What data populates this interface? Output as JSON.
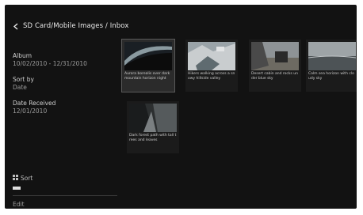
{
  "header": {
    "breadcrumb": "SD Card/Mobile Images / Inbox"
  },
  "details": {
    "album_label": "Album",
    "album_value": "10/02/2010 - 12/31/2010",
    "sort_label": "Sort by",
    "sort_value": "Date",
    "date_label": "Date Received",
    "date_value": "12/01/2010"
  },
  "sort_mode": {
    "label": "Sort",
    "icon": "grid-icon"
  },
  "footer": {
    "label": "Edit"
  },
  "thumbnails": [
    {
      "caption": "Aurora borealis over dark mountain horizon night",
      "icon": "image-thumbnail"
    },
    {
      "caption": "Hikers walking across a snowy hillside valley",
      "icon": "image-thumbnail"
    },
    {
      "caption": "Desert cabin and rocks under blue sky",
      "icon": "image-thumbnail"
    },
    {
      "caption": "Calm sea horizon with cloudy sky",
      "icon": "image-thumbnail"
    },
    {
      "caption": "Dark forest path with tall trees and leaves",
      "icon": "image-thumbnail"
    }
  ],
  "colors": {
    "background": "#121212",
    "focus_outline": "#5a5a5a",
    "text": "#d6d6d6"
  }
}
